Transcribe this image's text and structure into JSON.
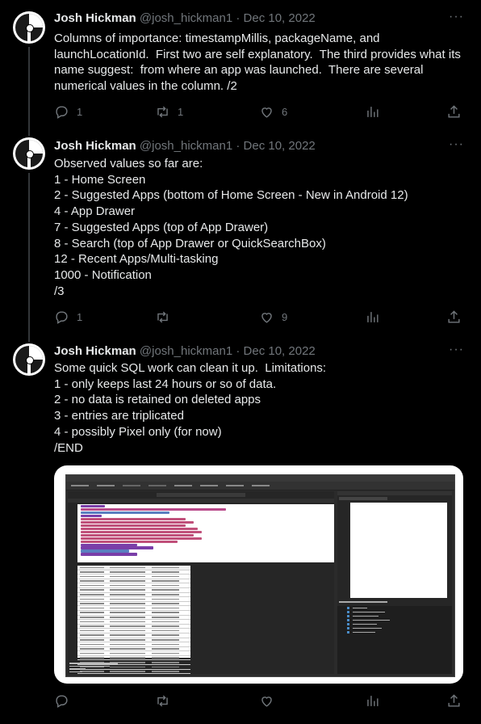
{
  "tweets": [
    {
      "author": {
        "name": "Josh Hickman",
        "handle": "@josh_hickman1"
      },
      "separator": "·",
      "date": "Dec 10, 2022",
      "text": "Columns of importance: timestampMillis, packageName, and launchLocationId.  First two are self explanatory.  The third provides what its name suggest:  from where an app was launched.  There are several numerical values in the column. /2",
      "stats": {
        "replies": "1",
        "retweets": "1",
        "likes": "6"
      }
    },
    {
      "author": {
        "name": "Josh Hickman",
        "handle": "@josh_hickman1"
      },
      "separator": "·",
      "date": "Dec 10, 2022",
      "text": "Observed values so far are:\n1 - Home Screen\n2 - Suggested Apps (bottom of Home Screen - New in Android 12)\n4 - App Drawer\n7 - Suggested Apps (top of App Drawer)\n8 - Search (top of App Drawer or QuickSearchBox)\n12 - Recent Apps/Multi-tasking\n1000 - Notification\n/3",
      "stats": {
        "replies": "1",
        "retweets": "",
        "likes": "9"
      }
    },
    {
      "author": {
        "name": "Josh Hickman",
        "handle": "@josh_hickman1"
      },
      "separator": "·",
      "date": "Dec 10, 2022",
      "text": "Some quick SQL work can clean it up.  Limitations:\n1 - only keeps last 24 hours or so of data.\n2 - no data is retained on deleted apps\n3 - entries are triplicated\n4 - possibly Pixel only (for now)\n/END",
      "stats": {
        "replies": "",
        "retweets": "",
        "likes": ""
      }
    }
  ],
  "more_icon": "more-dots-icon",
  "action_icons": [
    "reply-icon",
    "retweet-icon",
    "like-icon",
    "views-icon",
    "share-icon"
  ]
}
